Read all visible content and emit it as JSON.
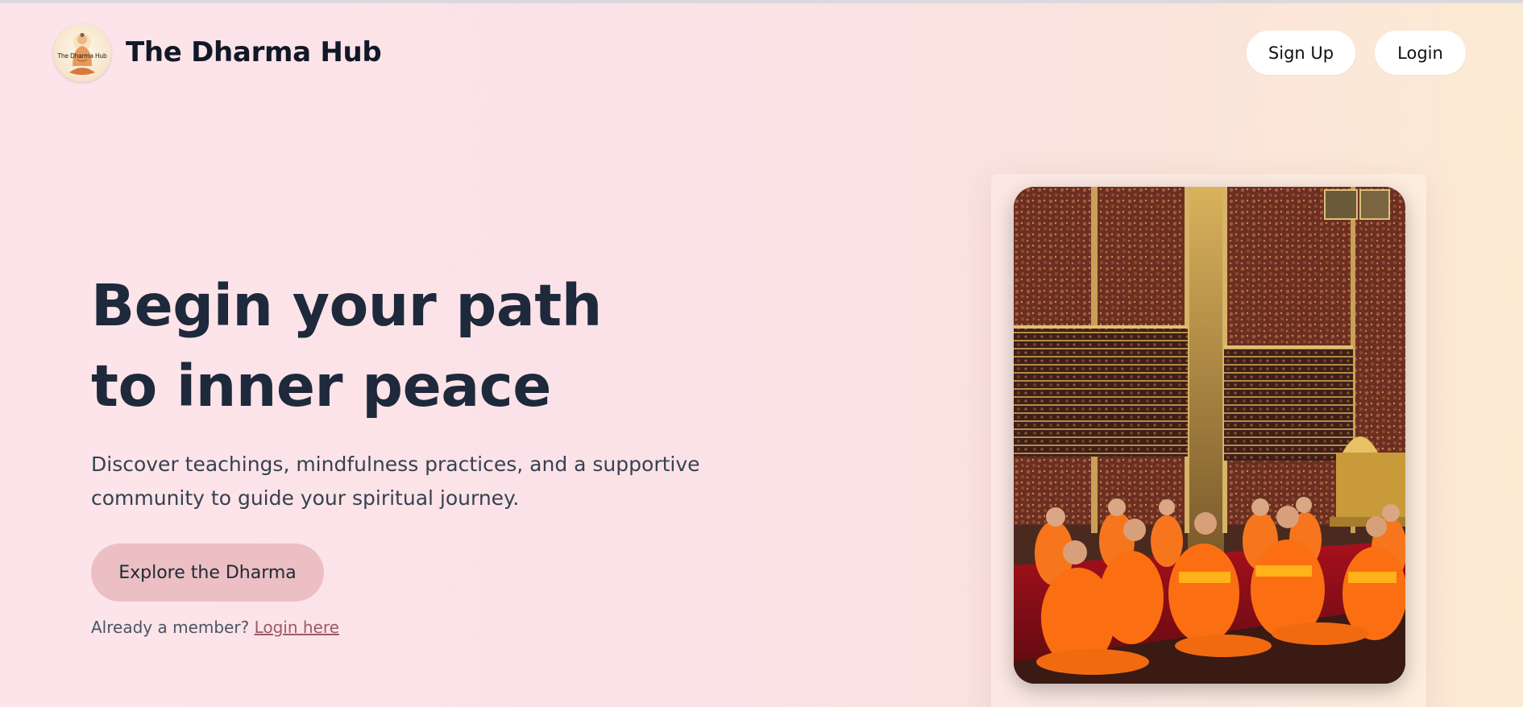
{
  "header": {
    "logo_text": "The Dharma Hub",
    "brand": "The Dharma Hub",
    "signup_label": "Sign Up",
    "login_label": "Login"
  },
  "hero": {
    "headline_line1": "Begin your path",
    "headline_line2": "to inner peace",
    "subtitle": "Discover teachings, mindfulness practices, and a supportive community to guide your spiritual journey.",
    "cta_label": "Explore the Dharma",
    "member_prompt": "Already a member?",
    "member_link": "Login here"
  },
  "image": {
    "subject": "monks-in-temple-photo",
    "icon": "buddha-icon"
  },
  "colors": {
    "headline": "#1e293b",
    "cta_bg": "#ebbfc3",
    "link": "#9b5b63",
    "robe": "#f97316"
  }
}
